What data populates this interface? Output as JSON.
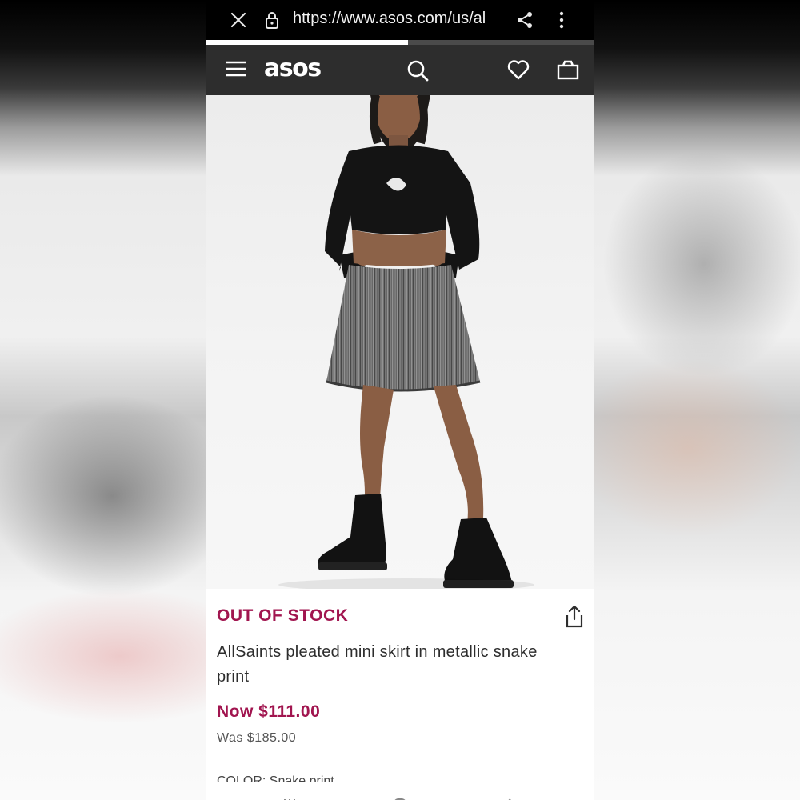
{
  "browser": {
    "url": "https://www.asos.com/us/al",
    "load_progress": 0.52
  },
  "header": {
    "logo": "asos"
  },
  "product": {
    "stock_status": "OUT OF STOCK",
    "name": "AllSaints pleated mini skirt in metallic snake print",
    "price_now": "Now $111.00",
    "price_was": "Was $185.00",
    "colour_label_partial": "COLOR: Snake print"
  },
  "colors": {
    "accent": "#a1154f",
    "header_bg": "#2d2d2d",
    "browser_bg": "#000000"
  },
  "icons": {
    "close": "close-icon",
    "lock": "lock-icon",
    "share": "share-icon",
    "more": "more-vert-icon",
    "menu": "hamburger-icon",
    "search": "search-icon",
    "wishlist": "heart-icon",
    "bag": "bag-icon",
    "share_product": "share-upload-icon"
  }
}
